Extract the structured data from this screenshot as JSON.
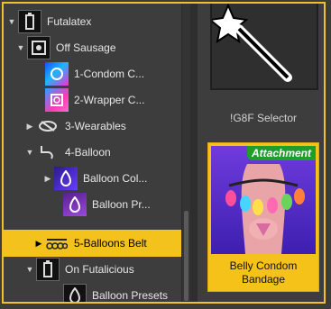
{
  "tree": {
    "rows": [
      {
        "label": "Futalatex",
        "arrow": "▼"
      },
      {
        "label": "Off Sausage",
        "arrow": "▼"
      },
      {
        "label": "1-Condom C...",
        "arrow": ""
      },
      {
        "label": "2-Wrapper C...",
        "arrow": ""
      },
      {
        "label": "3-Wearables",
        "arrow": "▶"
      },
      {
        "label": "4-Balloon",
        "arrow": "▼"
      },
      {
        "label": "Balloon Col...",
        "arrow": "▶"
      },
      {
        "label": "Balloon Pr...",
        "arrow": ""
      },
      {
        "label": "5-Balloons Belt",
        "arrow": "▶"
      },
      {
        "label": "On Futalicious",
        "arrow": "▼"
      },
      {
        "label": "Balloon Presets",
        "arrow": ""
      }
    ],
    "selected_index": 8
  },
  "presets": {
    "wand_label": "!G8F Selector",
    "product_badge": "Attachment",
    "product_caption_line1": "Belly Condom",
    "product_caption_line2": "Bandage"
  },
  "colors": {
    "accent": "#f4c21c",
    "badge": "#1f9e2a"
  }
}
